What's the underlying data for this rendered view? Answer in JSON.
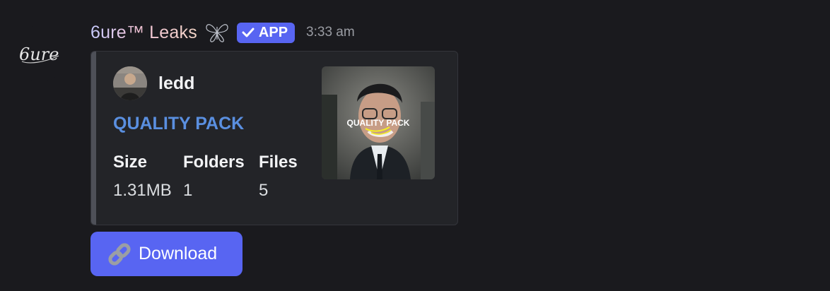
{
  "message": {
    "avatar_icon": "6ure-signature-logo-icon",
    "avatar_text": "6ure",
    "username": "6ure™ Leaks",
    "decoration_icon": "butterfly-icon",
    "badge": {
      "icon": "checkmark-icon",
      "label": "APP"
    },
    "timestamp": "3:33 am"
  },
  "embed": {
    "accent_color": "#4e5058",
    "author": {
      "name": "ledd",
      "avatar_icon": "author-avatar-photo"
    },
    "title": "QUALITY PACK",
    "title_color": "#5a8fe0",
    "fields": [
      {
        "name": "Size",
        "value": "1.31MB"
      },
      {
        "name": "Folders",
        "value": "1"
      },
      {
        "name": "Files",
        "value": "5"
      }
    ],
    "thumbnail": {
      "caption_text": "QUALITY PACK",
      "icon": "thumbnail-photo"
    }
  },
  "button": {
    "label": "Download",
    "icon": "link-icon",
    "color": "#5865f2"
  }
}
